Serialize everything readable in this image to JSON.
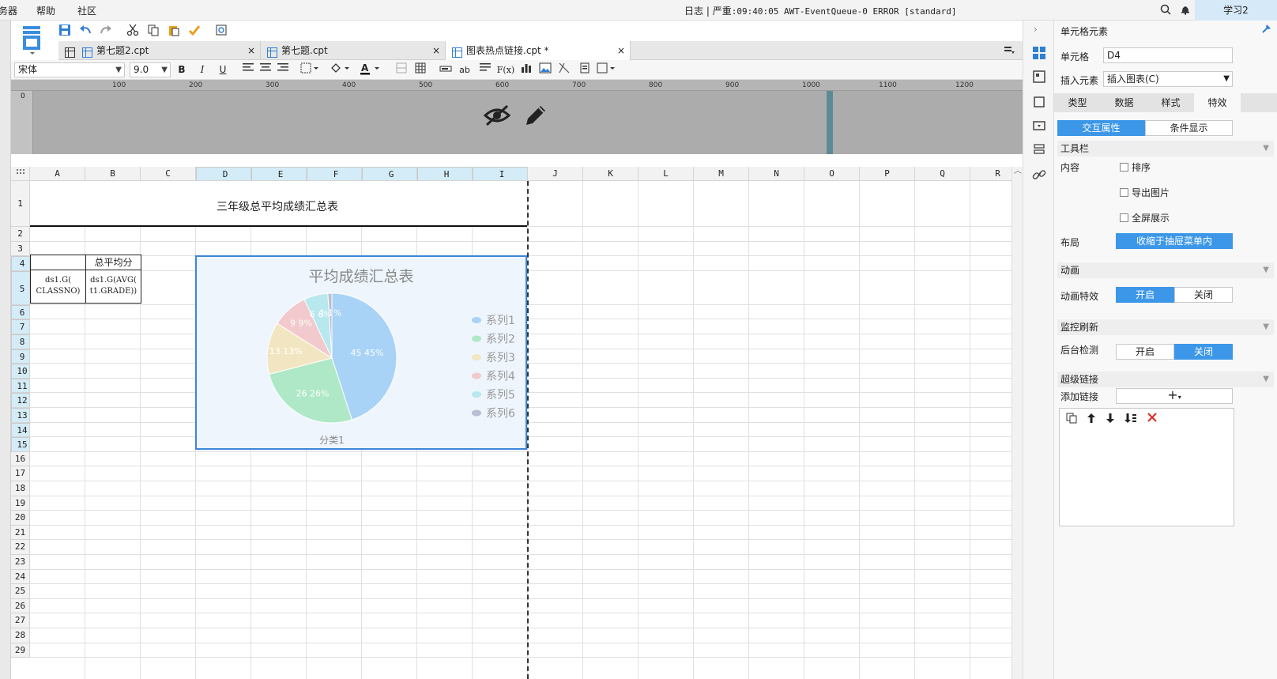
{
  "menu": {
    "partial": "务器",
    "help": "帮助",
    "community": "社区"
  },
  "log": {
    "label": "日志",
    "sep": "|",
    "level": "严重",
    "message": ":09:40:05 AWT-EventQueue-0 ERROR [standard]"
  },
  "user": {
    "name": "学习2"
  },
  "tabs": [
    {
      "label": "第七题2.cpt",
      "close": "×"
    },
    {
      "label": "第七题.cpt",
      "close": "×"
    },
    {
      "label": "图表热点链接.cpt *",
      "close": "×"
    }
  ],
  "format": {
    "font": "宋体",
    "size": "9.0",
    "bold": "B",
    "italic": "I",
    "underline": "U",
    "ab": "ab",
    "fx": "F(x)"
  },
  "ruler": {
    "ticks": [
      "100",
      "200",
      "300",
      "400",
      "500",
      "600",
      "700",
      "800",
      "900",
      "1000",
      "1100",
      "1200"
    ],
    "zero": "0"
  },
  "sheet": {
    "columns": [
      "A",
      "B",
      "C",
      "D",
      "E",
      "F",
      "G",
      "H",
      "I",
      "J",
      "K",
      "L",
      "M",
      "N",
      "O",
      "P",
      "Q",
      "R"
    ],
    "selected_columns": [
      "D",
      "E",
      "F",
      "G",
      "H",
      "I"
    ],
    "rows": [
      "1",
      "2",
      "3",
      "4",
      "5",
      "6",
      "7",
      "8",
      "9",
      "10",
      "11",
      "12",
      "13",
      "14",
      "15",
      "16",
      "17",
      "18",
      "19",
      "20",
      "21",
      "22",
      "23",
      "24",
      "25",
      "26",
      "27",
      "28",
      "29"
    ],
    "selected_rows": [
      "4",
      "5",
      "6",
      "7",
      "8",
      "9",
      "10",
      "11",
      "12",
      "13",
      "14",
      "15"
    ],
    "title_cell": "三年级总平均成绩汇总表",
    "header_b4": "总平均分",
    "cell_a5": "ds1.G(\nCLASSNO)",
    "cell_b5": "ds1.G(AVG(\nt1.GRADE))"
  },
  "chart_data": {
    "type": "pie",
    "title": "平均成绩汇总表",
    "categories": [
      "系列1",
      "系列2",
      "系列3",
      "系列4",
      "系列5",
      "系列6"
    ],
    "values": [
      45,
      26,
      13,
      9,
      6,
      1
    ],
    "labels": [
      "45  45%",
      "26  26%",
      "13  13%",
      "9  9%",
      "6  6%",
      "1  1%"
    ],
    "colors": [
      "#a9d3f6",
      "#aee8c6",
      "#f2e6c2",
      "#f2c9cc",
      "#b8e7ee",
      "#b9bfd3"
    ],
    "xlabel": "分类1",
    "legend_position": "right"
  },
  "panel": {
    "title": "单元格元素",
    "cell_label": "单元格",
    "cell_value": "D4",
    "insert_label": "插入元素",
    "insert_value": "插入图表(C)",
    "tabs": [
      "类型",
      "数据",
      "样式",
      "特效"
    ],
    "sub_tabs": [
      "交互属性",
      "条件显示"
    ],
    "toolbar_section": "工具栏",
    "content_label": "内容",
    "options": [
      "排序",
      "导出图片",
      "全屏展示"
    ],
    "layout_label": "布局",
    "layout_value": "收缩于抽屉菜单内",
    "anim_section": "动画",
    "anim_label": "动画特效",
    "on": "开启",
    "off": "关闭",
    "monitor_section": "监控刷新",
    "bg_check_label": "后台检测",
    "link_section": "超级链接",
    "add_link_label": "添加链接",
    "add_symbol": "+"
  }
}
